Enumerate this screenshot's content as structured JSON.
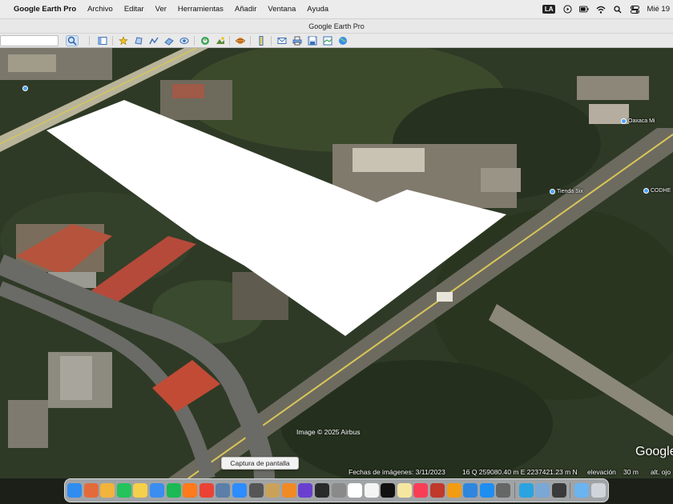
{
  "menubar": {
    "app_name": "Google Earth Pro",
    "menus": [
      "Archivo",
      "Editar",
      "Ver",
      "Herramientas",
      "Añadir",
      "Ventana",
      "Ayuda"
    ],
    "input_source": "LA",
    "clock": "Mié 19"
  },
  "window": {
    "title": "Google Earth Pro"
  },
  "map": {
    "places": [
      "Oaxaca Mi",
      "Tienda Six",
      "CODHE"
    ],
    "attribution": "Image © 2025 Airbus",
    "logo": "Google"
  },
  "statusbar": {
    "imagery_date": "Fechas de imágenes: 3/11/2023",
    "coordinates": "16 Q 259080.40 m E 2237421.23 m N",
    "elevation_label": "elevación",
    "elevation_value": "30 m",
    "eye_alt_label": "alt. ojo"
  },
  "tooltip": {
    "text": "Captura de pantalla"
  },
  "toolbar_icons": [
    "search-icon",
    "sidebar-icon",
    "placemark-icon",
    "polygon-icon",
    "path-icon",
    "image-overlay-icon",
    "record-tour-icon",
    "historical-imagery-icon",
    "sunlight-icon",
    "planets-icon",
    "ruler-icon",
    "email-icon",
    "print-icon",
    "save-image-icon",
    "maps-icon"
  ],
  "dock_apps": [
    {
      "name": "finder-icon",
      "color": "#2f8cf0"
    },
    {
      "name": "launchpad-icon",
      "color": "#e36b3b"
    },
    {
      "name": "photos-icon",
      "color": "#f2b43a"
    },
    {
      "name": "whatsapp-icon",
      "color": "#25c35b"
    },
    {
      "name": "notes-icon",
      "color": "#f5d04a"
    },
    {
      "name": "safari-icon",
      "color": "#3b8df0"
    },
    {
      "name": "spotify-icon",
      "color": "#1db954"
    },
    {
      "name": "firefox-icon",
      "color": "#ff7a1a"
    },
    {
      "name": "chrome-icon",
      "color": "#ea4335"
    },
    {
      "name": "google-earth-icon",
      "color": "#5b7fa8"
    },
    {
      "name": "zoom-icon",
      "color": "#2d8cff"
    },
    {
      "name": "screenshot-icon",
      "color": "#555555"
    },
    {
      "name": "archive-icon",
      "color": "#c9a25a"
    },
    {
      "name": "books-icon",
      "color": "#f08a24"
    },
    {
      "name": "screen-recorder-icon",
      "color": "#6a3fd0"
    },
    {
      "name": "music-creator-icon",
      "color": "#2a2a2a"
    },
    {
      "name": "settings-icon",
      "color": "#8a8a8a"
    },
    {
      "name": "calendar-icon",
      "color": "#ffffff"
    },
    {
      "name": "reminders-icon",
      "color": "#f4f4f4"
    },
    {
      "name": "apple-tv-icon",
      "color": "#111111"
    },
    {
      "name": "stickies-icon",
      "color": "#f6e7a0"
    },
    {
      "name": "music-icon",
      "color": "#fa3d56"
    },
    {
      "name": "dictionary-icon",
      "color": "#c0392b"
    },
    {
      "name": "pages-icon",
      "color": "#f39c12"
    },
    {
      "name": "keynote-icon",
      "color": "#2e86de"
    },
    {
      "name": "app-store-icon",
      "color": "#1f8ef1"
    },
    {
      "name": "compressor-icon",
      "color": "#666666"
    },
    {
      "name": "telegram-icon",
      "color": "#2aa3e0"
    },
    {
      "name": "preview-icon",
      "color": "#7aa7d6"
    },
    {
      "name": "quicktime-icon",
      "color": "#3a3a3a"
    },
    {
      "name": "downloads-folder-icon",
      "color": "#6ab4f0"
    },
    {
      "name": "trash-icon",
      "color": "#cfd5da"
    }
  ],
  "colors": {
    "selection_polygon": "#ffffff",
    "place_pin": "#4aa3ff",
    "road": "#c9c4a0"
  }
}
